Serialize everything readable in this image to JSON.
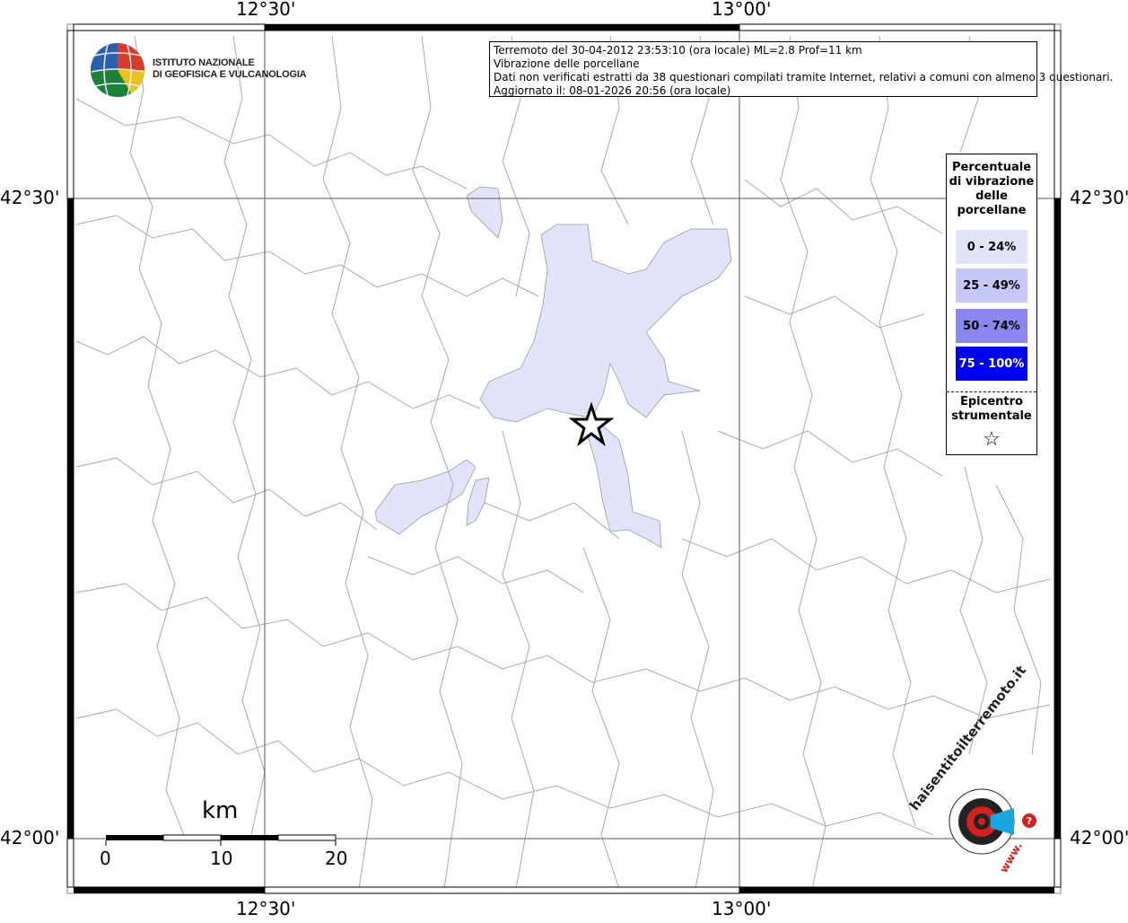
{
  "map": {
    "lon_labels": [
      "12°30'",
      "13°00'"
    ],
    "lat_labels": [
      "42°30'",
      "42°00'"
    ]
  },
  "info": {
    "line1": "Terremoto del 30-04-2012 23:53:10 (ora locale) ML=2.8 Prof=11 km",
    "line2": "Vibrazione delle porcellane",
    "line3": "Dati non verificati estratti da 38 questionari compilati tramite Internet, relativi a comuni con almeno 3 questionari.",
    "line4": "Aggiornato il: 08-01-2026 20:56 (ora locale)"
  },
  "legend": {
    "title_lines": [
      "Percentuale",
      "di vibrazione",
      "delle",
      "porcellane"
    ],
    "classes": [
      {
        "label": "0 - 24%",
        "color": "#e3e4fb",
        "text_color": "#000000"
      },
      {
        "label": "25 - 49%",
        "color": "#c6c7f6",
        "text_color": "#000000"
      },
      {
        "label": "50 - 74%",
        "color": "#8888f0",
        "text_color": "#000000"
      },
      {
        "label": "75 - 100%",
        "color": "#0000ee",
        "text_color": "#ffffff"
      }
    ],
    "epicenter_lines": [
      "Epicentro",
      "strumentale"
    ],
    "epicenter_symbol": "☆"
  },
  "logos": {
    "ingv_line1": "ISTITUTO NAZIONALE",
    "ingv_line2": "DI GEOFISICA E VULCANOLOGIA",
    "hai_sentito": "haisentitoilterremoto.it",
    "www": "www."
  },
  "scale": {
    "unit": "km",
    "ticks": [
      "0",
      "10",
      "20"
    ]
  },
  "colors": {
    "felt_area": "#e3e4fb",
    "borders": "#9a9a9a",
    "frame": "#000000"
  }
}
